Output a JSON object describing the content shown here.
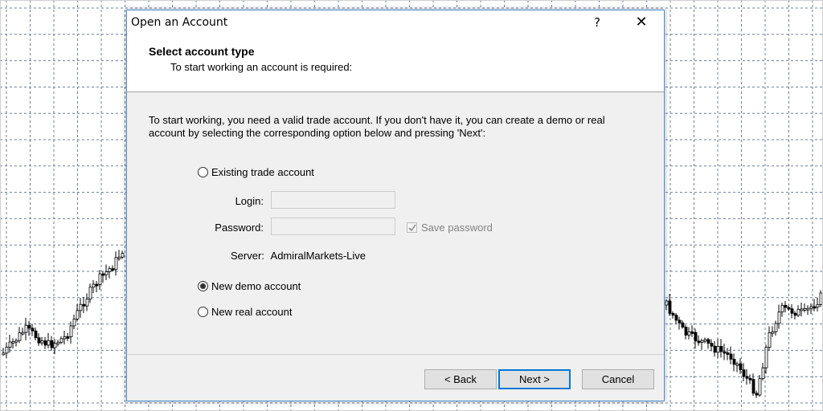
{
  "dialog": {
    "title": "Open an Account",
    "help_glyph": "?",
    "close_glyph": "✕"
  },
  "header": {
    "title": "Select account type",
    "subtitle": "To start working an account is required:"
  },
  "intro": {
    "line1": "To start working, you need a valid trade account. If you don't have it, you can create a demo or real",
    "line2": "account by selecting the corresponding option below and pressing 'Next':"
  },
  "options": {
    "existing": {
      "label": "Existing trade account",
      "selected": false
    },
    "demo": {
      "label": "New demo account",
      "selected": true
    },
    "real": {
      "label": "New real account",
      "selected": false
    }
  },
  "login": {
    "label": "Login:",
    "value": ""
  },
  "password": {
    "label": "Password:",
    "value": ""
  },
  "save_password": {
    "label": "Save password",
    "checked": true
  },
  "server": {
    "label": "Server:",
    "value": "AdmiralMarkets-Live"
  },
  "buttons": {
    "back": "< Back",
    "next": "Next >",
    "cancel": "Cancel"
  },
  "colors": {
    "accent": "#0078d7",
    "dialog_bg": "#f0f0f0",
    "grid_line": "#6f7f92"
  }
}
